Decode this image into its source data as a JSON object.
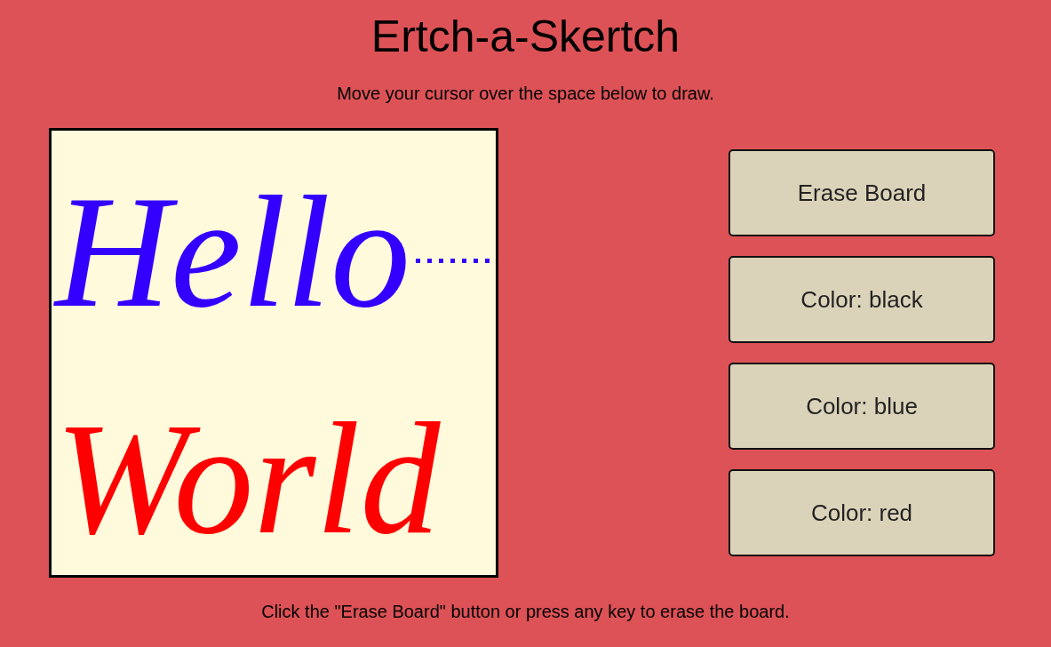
{
  "title": "Ertch-a-Skertch",
  "instructions": "Move your cursor over the space below to draw.",
  "board": {
    "strokes": [
      {
        "text": "Hello",
        "color": "#3300ff"
      },
      {
        "text": "World",
        "color": "#ff0000"
      }
    ]
  },
  "buttons": [
    {
      "label": "Erase Board"
    },
    {
      "label": "Color: black"
    },
    {
      "label": "Color: blue"
    },
    {
      "label": "Color: red"
    }
  ],
  "footer": "Click the \"Erase Board\" button or press any key to erase the board."
}
